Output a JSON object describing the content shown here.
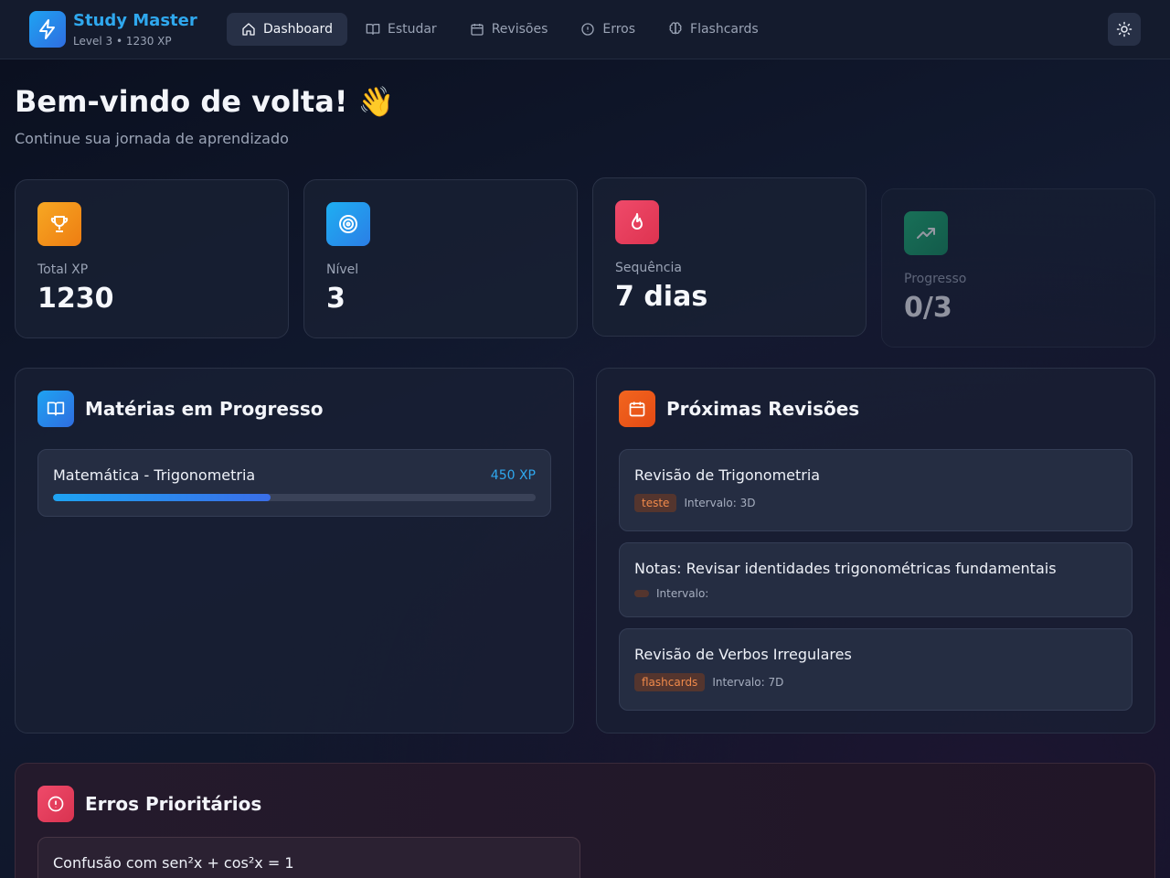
{
  "brand": {
    "title": "Study Master",
    "subtitle": "Level 3 • 1230 XP",
    "icon": "lightning-icon"
  },
  "nav": [
    {
      "label": "Dashboard",
      "icon": "home-icon",
      "active": true
    },
    {
      "label": "Estudar",
      "icon": "book-open-icon"
    },
    {
      "label": "Revisões",
      "icon": "calendar-icon"
    },
    {
      "label": "Erros",
      "icon": "alert-circle-icon"
    },
    {
      "label": "Flashcards",
      "icon": "brain-icon"
    }
  ],
  "theme_toggle_icon": "sun-icon",
  "welcome": {
    "title": "Bem-vindo de volta! 👋",
    "subtitle": "Continue sua jornada de aprendizado"
  },
  "stats": [
    {
      "label": "Total XP",
      "value": "1230",
      "icon": "trophy-icon",
      "color": "#f59a1d"
    },
    {
      "label": "Nível",
      "value": "3",
      "icon": "target-icon",
      "color": "#1ea3f2"
    },
    {
      "label": "Sequência",
      "value": "7 dias",
      "icon": "flame-icon",
      "color": "#e8405a"
    },
    {
      "label": "Progresso",
      "value": "0/3",
      "icon": "trending-up-icon",
      "color": "#1ea66a"
    }
  ],
  "subjects": {
    "title": "Matérias em Progresso",
    "icon": "book-open-icon",
    "items": [
      {
        "name": "Matemática - Trigonometria",
        "xp": "450 XP",
        "progress": 0.45
      }
    ]
  },
  "reviews": {
    "title": "Próximas Revisões",
    "icon": "calendar-icon",
    "items": [
      {
        "title": "Revisão de Trigonometria",
        "tag": "teste",
        "interval": "Intervalo: 3D"
      },
      {
        "title": "Notas: Revisar identidades trigonométricas fundamentais",
        "tag": "",
        "interval": "Intervalo:"
      },
      {
        "title": "Revisão de Verbos Irregulares",
        "tag": "flashcards",
        "interval": "Intervalo: 7D"
      }
    ]
  },
  "errors": {
    "title": "Erros Prioritários",
    "icon": "alert-circle-icon",
    "items": [
      {
        "text": "Confusão com sen²x + cos²x = 1"
      }
    ]
  },
  "colors": {
    "accent": "#2fa8ee",
    "review_icon": "#f0561c",
    "error_icon": "#e8405a"
  }
}
